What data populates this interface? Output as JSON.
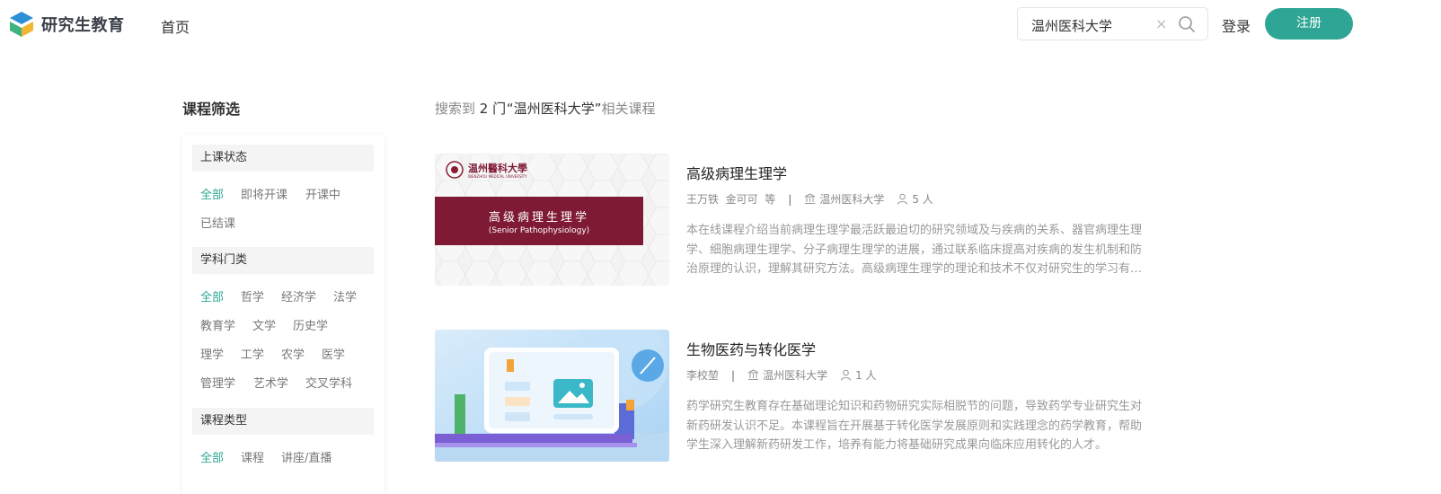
{
  "header": {
    "logo_text": "研究生教育",
    "nav_home": "首页",
    "search": {
      "value": "温州医科大学"
    },
    "login": "登录",
    "register": "注册",
    "accent_color": "#2fa695"
  },
  "sidebar": {
    "title": "课程筛选",
    "groups": [
      {
        "label": "上课状态",
        "options": [
          "全部",
          "即将开课",
          "开课中",
          "已结课"
        ],
        "selected": "全部"
      },
      {
        "label": "学科门类",
        "options": [
          "全部",
          "哲学",
          "经济学",
          "法学",
          "教育学",
          "文学",
          "历史学",
          "理学",
          "工学",
          "农学",
          "医学",
          "管理学",
          "艺术学",
          "交叉学科"
        ],
        "selected": "全部"
      },
      {
        "label": "课程类型",
        "options": [
          "全部",
          "课程",
          "讲座/直播"
        ],
        "selected": "全部"
      }
    ]
  },
  "results": {
    "summary_prefix": "搜索到",
    "summary_count": "2",
    "summary_unit": "门",
    "summary_query": "“温州医科大学”",
    "summary_suffix": "相关课程",
    "courses": [
      {
        "title": "高级病理生理学",
        "teachers": "王万铁  金可可  等",
        "school": "温州医科大学",
        "learners": "5 人",
        "description": "本在线课程介绍当前病理生理学最活跃最迫切的研究领域及与疾病的关系、器官病理生理学、细胞病理生理学、分子病理生理学的进展，通过联系临床提高对疾病的发生机制和防治原理的认识，理解其研究方法。高级病理生理学的理论和技术不仅对研究生的学习有帮助，对临床医生也有重要意义。",
        "thumb": {
          "school_logo_text": "温州醫科大學",
          "school_en": "WENZHOU MEDICAL UNIVERSITY",
          "banner_title": "高级病理生理学",
          "banner_subtitle": "(Senior Pathophysiology)"
        }
      },
      {
        "title": "生物医药与转化医学",
        "teachers": "李校堃",
        "school": "温州医科大学",
        "learners": "1 人",
        "description": "药学研究生教育存在基础理论知识和药物研究实际相脱节的问题，导致药学专业研究生对新药研发认识不足。本课程旨在开展基于转化医学发展原则和实践理念的药学教育，帮助学生深入理解新药研发工作，培养有能力将基础研究成果向临床应用转化的人才。"
      }
    ]
  }
}
